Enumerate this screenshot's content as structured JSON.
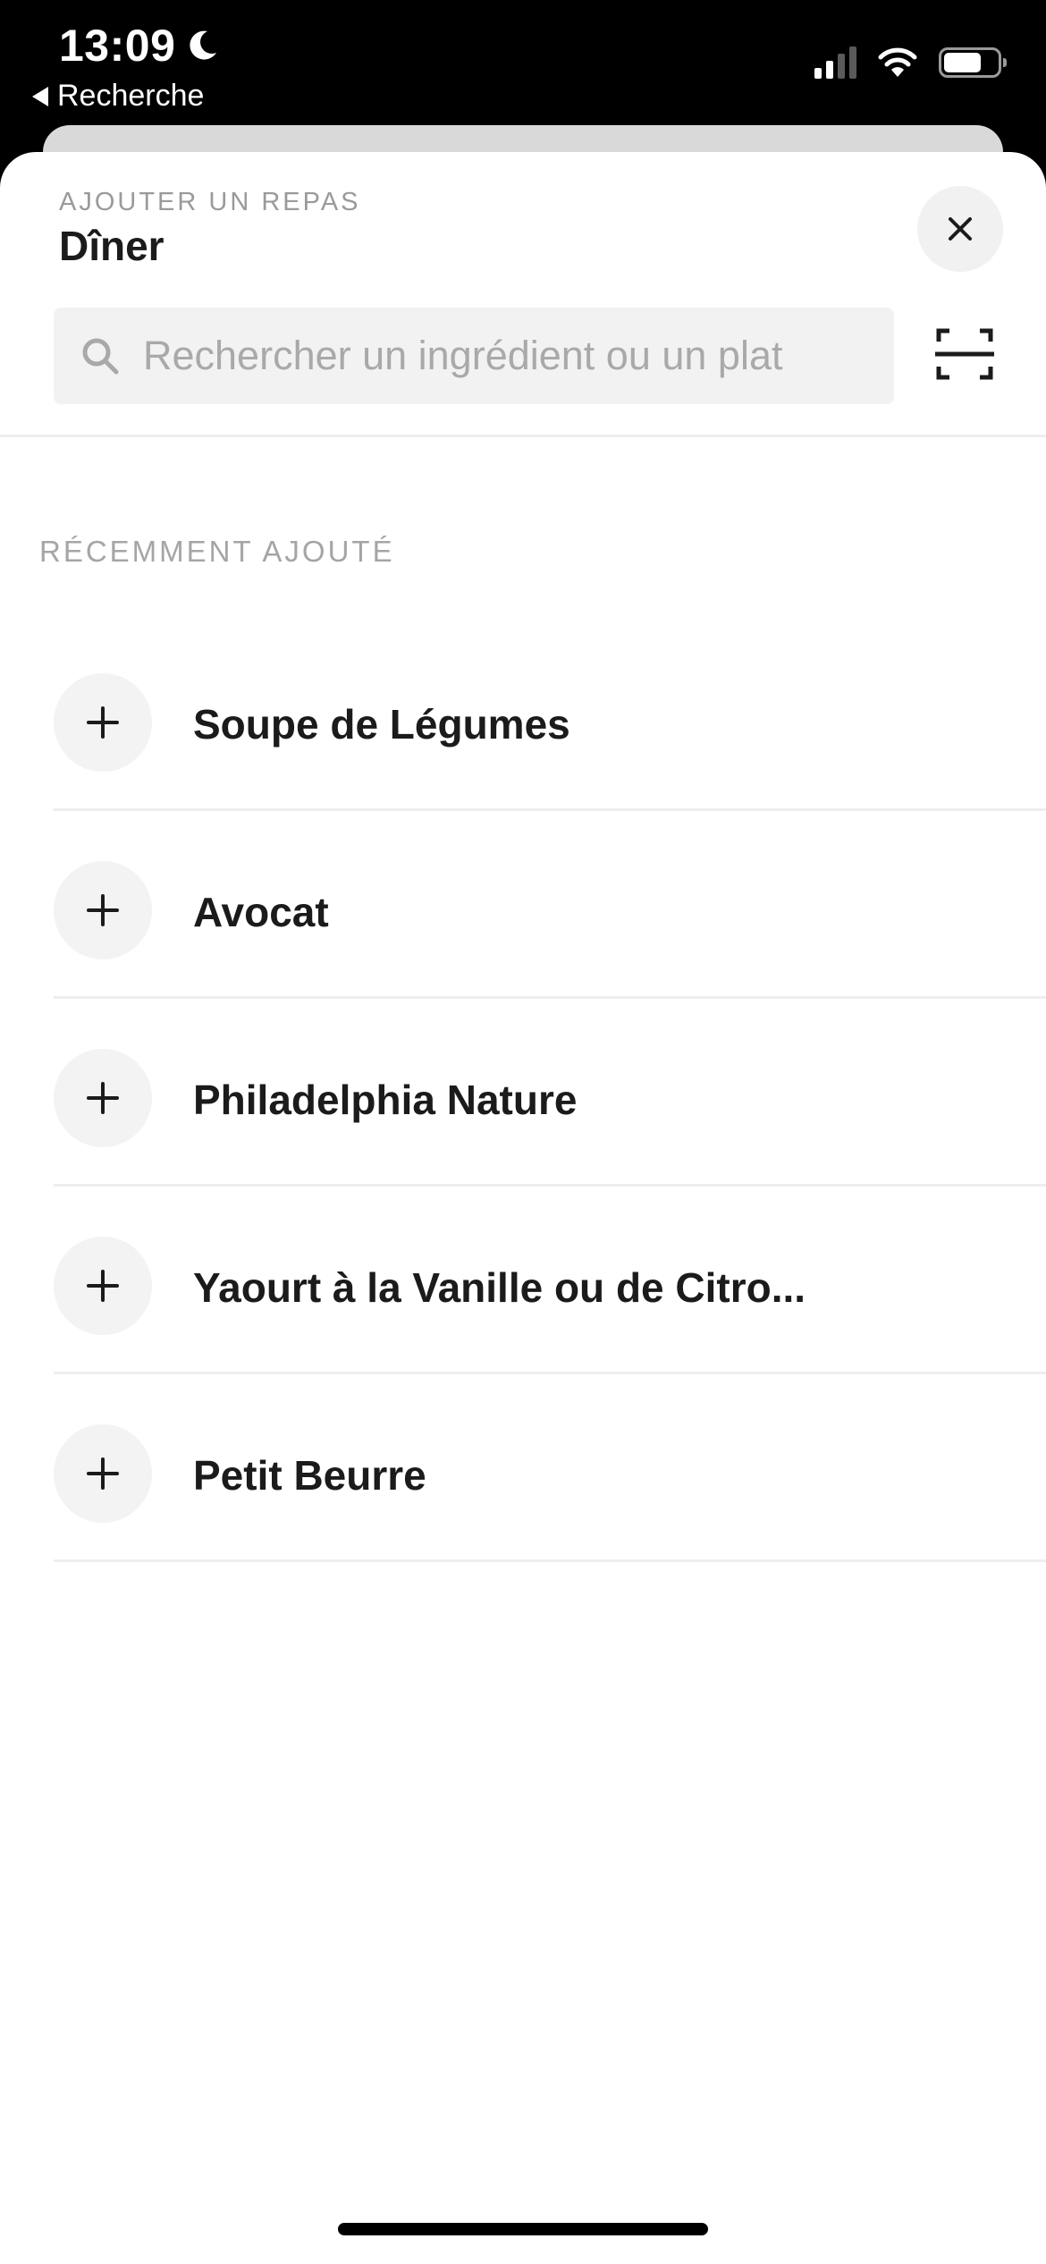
{
  "status_bar": {
    "time": "13:09",
    "back_label": "Recherche"
  },
  "sheet": {
    "subtitle": "AJOUTER UN REPAS",
    "title": "Dîner"
  },
  "search": {
    "placeholder": "Rechercher un ingrédient ou un plat"
  },
  "section": {
    "label": "RÉCEMMENT AJOUTÉ"
  },
  "recent_items": [
    {
      "label": "Soupe de Légumes"
    },
    {
      "label": "Avocat"
    },
    {
      "label": "Philadelphia Nature"
    },
    {
      "label": "Yaourt à la Vanille ou de Citro..."
    },
    {
      "label": "Petit Beurre"
    }
  ],
  "icons": {
    "moon": "moon-icon",
    "back": "back-arrow-icon",
    "signal": "cellular-signal-icon",
    "wifi": "wifi-icon",
    "battery": "battery-icon",
    "close": "close-icon",
    "search": "search-icon",
    "scan": "barcode-scan-icon",
    "add": "plus-icon"
  },
  "status": {
    "battery_level": 0.7,
    "signal_bars": 2,
    "signal_bars_total": 4
  },
  "colors": {
    "background": "#ffffff",
    "text_primary": "#1b1b1b",
    "text_muted": "#a5a5a5",
    "field_bg": "#f2f2f2"
  }
}
